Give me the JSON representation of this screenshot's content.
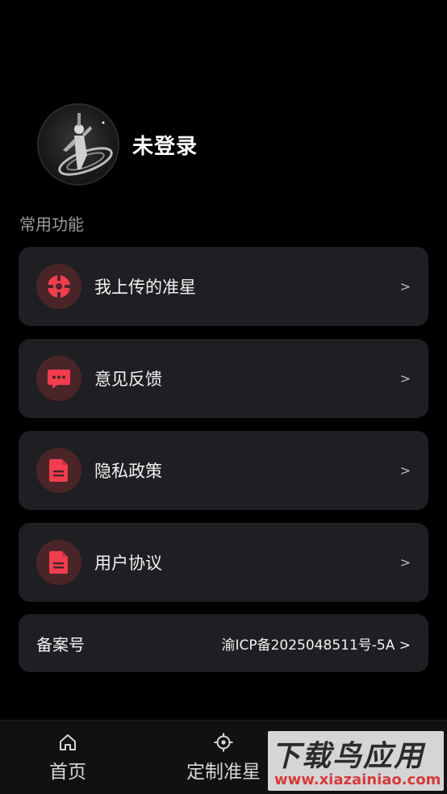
{
  "profile": {
    "username": "未登录"
  },
  "section": {
    "title": "常用功能"
  },
  "menu": [
    {
      "label": "我上传的准星",
      "icon": "crosshair-icon",
      "chevron": ">"
    },
    {
      "label": "意见反馈",
      "icon": "chat-bubble-icon",
      "chevron": ">"
    },
    {
      "label": "隐私政策",
      "icon": "document-icon",
      "chevron": ">"
    },
    {
      "label": "用户协议",
      "icon": "document-icon",
      "chevron": ">"
    }
  ],
  "record": {
    "label": "备案号",
    "value": "渝ICP备2025048511号-5A >"
  },
  "tabbar": [
    {
      "label": "首页",
      "icon": "home-icon"
    },
    {
      "label": "定制准星",
      "icon": "target-icon"
    }
  ],
  "watermark": {
    "top": "下载鸟应用",
    "bottom": "www.xiazainiao.com"
  },
  "colors": {
    "accent": "#f23d4f",
    "icon_bg": "#4a2528",
    "card_bg": "#1f1f23",
    "background": "#000000"
  }
}
